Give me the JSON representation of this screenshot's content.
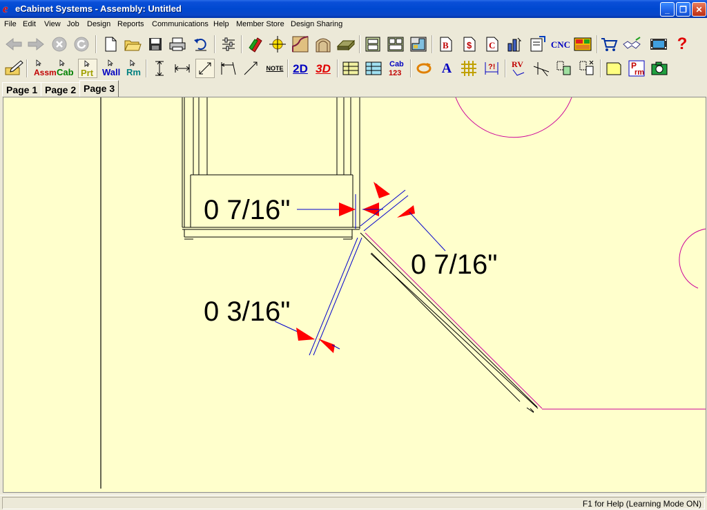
{
  "window": {
    "title": "eCabinet Systems - Assembly: Untitled",
    "icon_glyph": "e",
    "minimize_label": "_",
    "maximize_label": "❐",
    "close_label": "✕"
  },
  "menu": {
    "items": [
      "File",
      "Edit",
      "View",
      "Job",
      "Design",
      "Reports",
      "Communications",
      "Help",
      "Member Store",
      "Design Sharing"
    ]
  },
  "toolbar1": {
    "cnc_label": "CNC",
    "help_label": "?",
    "bid_letter": "B",
    "price_letter": "$",
    "cutlist_letter": "C"
  },
  "toolbar2": {
    "assm_label": "Assm",
    "cab_label": "Cab",
    "prt_label": "Prt",
    "wall_label": "Wall",
    "rm_label": "Rm",
    "note_label": "NOTE",
    "view2d_label": "2D",
    "view3d_label": "3D",
    "cab123_top": "Cab",
    "cab123_bottom": "123",
    "text_label": "A",
    "rv_label": "RV",
    "prm_top": "P",
    "prm_bottom": "rm"
  },
  "tabs": {
    "items": [
      "Page 1",
      "Page 2",
      "Page 3"
    ],
    "active": "Page 3"
  },
  "drawing": {
    "background_color": "#ffffcc",
    "dimension_labels": [
      "0 7/16\"",
      "0 7/16\"",
      "0 3/16\""
    ],
    "colors": {
      "line": "#000000",
      "dimension_line": "#0000cc",
      "arrow": "#ff0000",
      "magenta": "#cc0099"
    }
  },
  "status": {
    "text": "F1 for Help (Learning Mode ON)"
  }
}
